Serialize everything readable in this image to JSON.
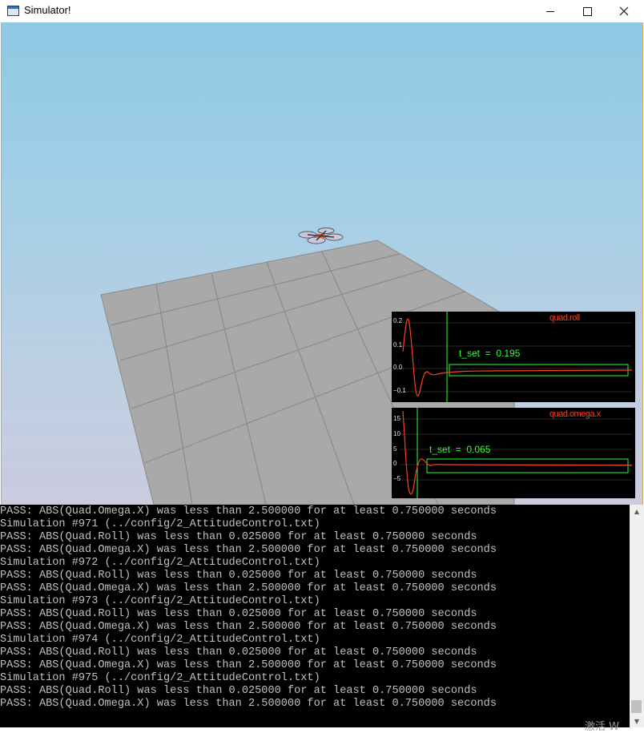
{
  "window": {
    "title": "Simulator!",
    "controls": {
      "minimize": "minimize-icon",
      "maximize": "maximize-icon",
      "close": "close-icon"
    }
  },
  "plots": [
    {
      "name": "quad.roll",
      "t_set_label": "t_set",
      "t_set_eq": "=",
      "t_set_value": "0.195",
      "yticks": [
        "0.2",
        "0.1",
        "0.0",
        "−0.1"
      ]
    },
    {
      "name": "quad.omega.x",
      "t_set_label": "t_set",
      "t_set_eq": "=",
      "t_set_value": "0.065",
      "yticks": [
        "15",
        "10",
        "5",
        "0",
        "−5"
      ]
    }
  ],
  "console": {
    "lines": [
      "PASS: ABS(Quad.Omega.X) was less than 2.500000 for at least 0.750000 seconds",
      "Simulation #971 (../config/2_AttitudeControl.txt)",
      "PASS: ABS(Quad.Roll) was less than 0.025000 for at least 0.750000 seconds",
      "PASS: ABS(Quad.Omega.X) was less than 2.500000 for at least 0.750000 seconds",
      "Simulation #972 (../config/2_AttitudeControl.txt)",
      "PASS: ABS(Quad.Roll) was less than 0.025000 for at least 0.750000 seconds",
      "PASS: ABS(Quad.Omega.X) was less than 2.500000 for at least 0.750000 seconds",
      "Simulation #973 (../config/2_AttitudeControl.txt)",
      "PASS: ABS(Quad.Roll) was less than 0.025000 for at least 0.750000 seconds",
      "PASS: ABS(Quad.Omega.X) was less than 2.500000 for at least 0.750000 seconds",
      "Simulation #974 (../config/2_AttitudeControl.txt)",
      "PASS: ABS(Quad.Roll) was less than 0.025000 for at least 0.750000 seconds",
      "PASS: ABS(Quad.Omega.X) was less than 2.500000 for at least 0.750000 seconds",
      "Simulation #975 (../config/2_AttitudeControl.txt)",
      "PASS: ABS(Quad.Roll) was less than 0.025000 for at least 0.750000 seconds",
      "PASS: ABS(Quad.Omega.X) was less than 2.500000 for at least 0.750000 seconds"
    ]
  },
  "watermark": "激活 W",
  "colors": {
    "plot_trace": "#ff4020",
    "plot_marker": "#30ff30",
    "console_text": "#c0c0c0",
    "console_bg": "#000000"
  }
}
